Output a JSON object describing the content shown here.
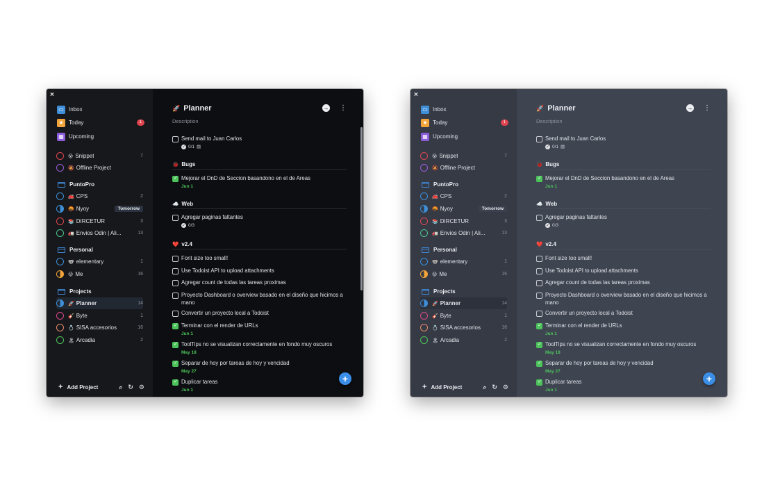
{
  "close_label": "×",
  "sidebar": {
    "nav": [
      {
        "label": "Inbox",
        "icon": "inbox-icon",
        "color": "#3e8ed8",
        "glyph": "▭"
      },
      {
        "label": "Today",
        "icon": "star-icon",
        "color": "#f2a43a",
        "glyph": "★",
        "badge": "1"
      },
      {
        "label": "Upcoming",
        "icon": "calendar-icon",
        "color": "#8b5bd9",
        "glyph": "▦"
      }
    ],
    "projects_top": [
      {
        "emoji": "😵",
        "label": "Snippet",
        "count": "7",
        "ring": "#e0454f"
      },
      {
        "emoji": "🔕",
        "label": "Offline Project",
        "count": "",
        "ring": "#9b5bd9"
      }
    ],
    "areas": [
      {
        "label": "PuntoPro",
        "projects": [
          {
            "emoji": "🚒",
            "label": "CPS",
            "count": "2",
            "ring": "#3e8ed8"
          },
          {
            "emoji": "🤬",
            "label": "Nyoy",
            "count": "",
            "tag": "Tomorrow",
            "ring": "#3e8ed8",
            "partial": true
          },
          {
            "emoji": "📚",
            "label": "DIRCETUR",
            "count": "3",
            "ring": "#e0454f"
          },
          {
            "emoji": "🚛",
            "label": "Envios Odin | Ali...",
            "count": "13",
            "ring": "#4cc48f"
          }
        ]
      },
      {
        "label": "Personal",
        "projects": [
          {
            "emoji": "🐨",
            "label": "elementary",
            "count": "1",
            "ring": "#3e8ed8"
          },
          {
            "emoji": "😜",
            "label": "Me",
            "count": "16",
            "ring": "#f2a43a",
            "partial": true
          }
        ]
      },
      {
        "label": "Projects",
        "projects": [
          {
            "emoji": "🚀",
            "label": "Planner",
            "count": "14",
            "ring": "#3e8ed8",
            "partial": true,
            "active": true
          },
          {
            "emoji": "🎸",
            "label": "Byte",
            "count": "1",
            "ring": "#d9478a"
          },
          {
            "emoji": "💍",
            "label": "SISA accesorios",
            "count": "16",
            "ring": "#e88a6a"
          },
          {
            "emoji": "🏝",
            "label": "Arcadia",
            "count": "2",
            "ring": "#4cc45b"
          }
        ]
      }
    ],
    "add_project": "Add Project",
    "tools": [
      {
        "icon": "search-icon",
        "glyph": "⌕"
      },
      {
        "icon": "sync-icon",
        "glyph": "↻"
      },
      {
        "icon": "gear-icon",
        "glyph": "⚙"
      }
    ]
  },
  "main": {
    "title_emoji": "🚀",
    "title": "Planner",
    "description": "Description",
    "header_icons": [
      "arrow-right-icon",
      "more-vertical-icon"
    ],
    "loose_task": {
      "label": "Send mail to Juan Carlos",
      "checklist": "0/1",
      "note_icon": "note-icon"
    },
    "sections": [
      {
        "emoji": "🐞",
        "label": "Bugs",
        "tasks": [
          {
            "label": "Mejorar el DnD de Seccion basandono en el de Areas",
            "done": true,
            "date": "Jun  1"
          }
        ]
      },
      {
        "emoji": "☁️",
        "label": "Web",
        "tasks": [
          {
            "label": "Agregar paginas faltantes",
            "done": false,
            "checklist": "0/3"
          }
        ]
      },
      {
        "emoji": "❤️",
        "label": "v2.4",
        "tasks": [
          {
            "label": "Font size too small!",
            "done": false
          },
          {
            "label": "Use Todoist API to upload attachments",
            "done": false
          },
          {
            "label": "Agregar count de todas las tareas proximas",
            "done": false
          },
          {
            "label": "Proyecto Dashboard o overview basado en el diseño que hicimos a mano",
            "done": false
          },
          {
            "label": "Convertir un proyecto local a Todoist",
            "done": false
          },
          {
            "label": "Terminar con el render de URLs",
            "done": true,
            "date": "Jun  1"
          },
          {
            "label": "ToolTips no se visualizan correctamente en fondo muy oscuros",
            "done": true,
            "date": "May 18"
          },
          {
            "label": "Separar de hoy por tareas de hoy y vencidad",
            "done": true,
            "date": "May 27"
          },
          {
            "label": "Duplicar tareas",
            "done": true,
            "date": "Jun  1"
          }
        ]
      }
    ],
    "fab": "+"
  }
}
